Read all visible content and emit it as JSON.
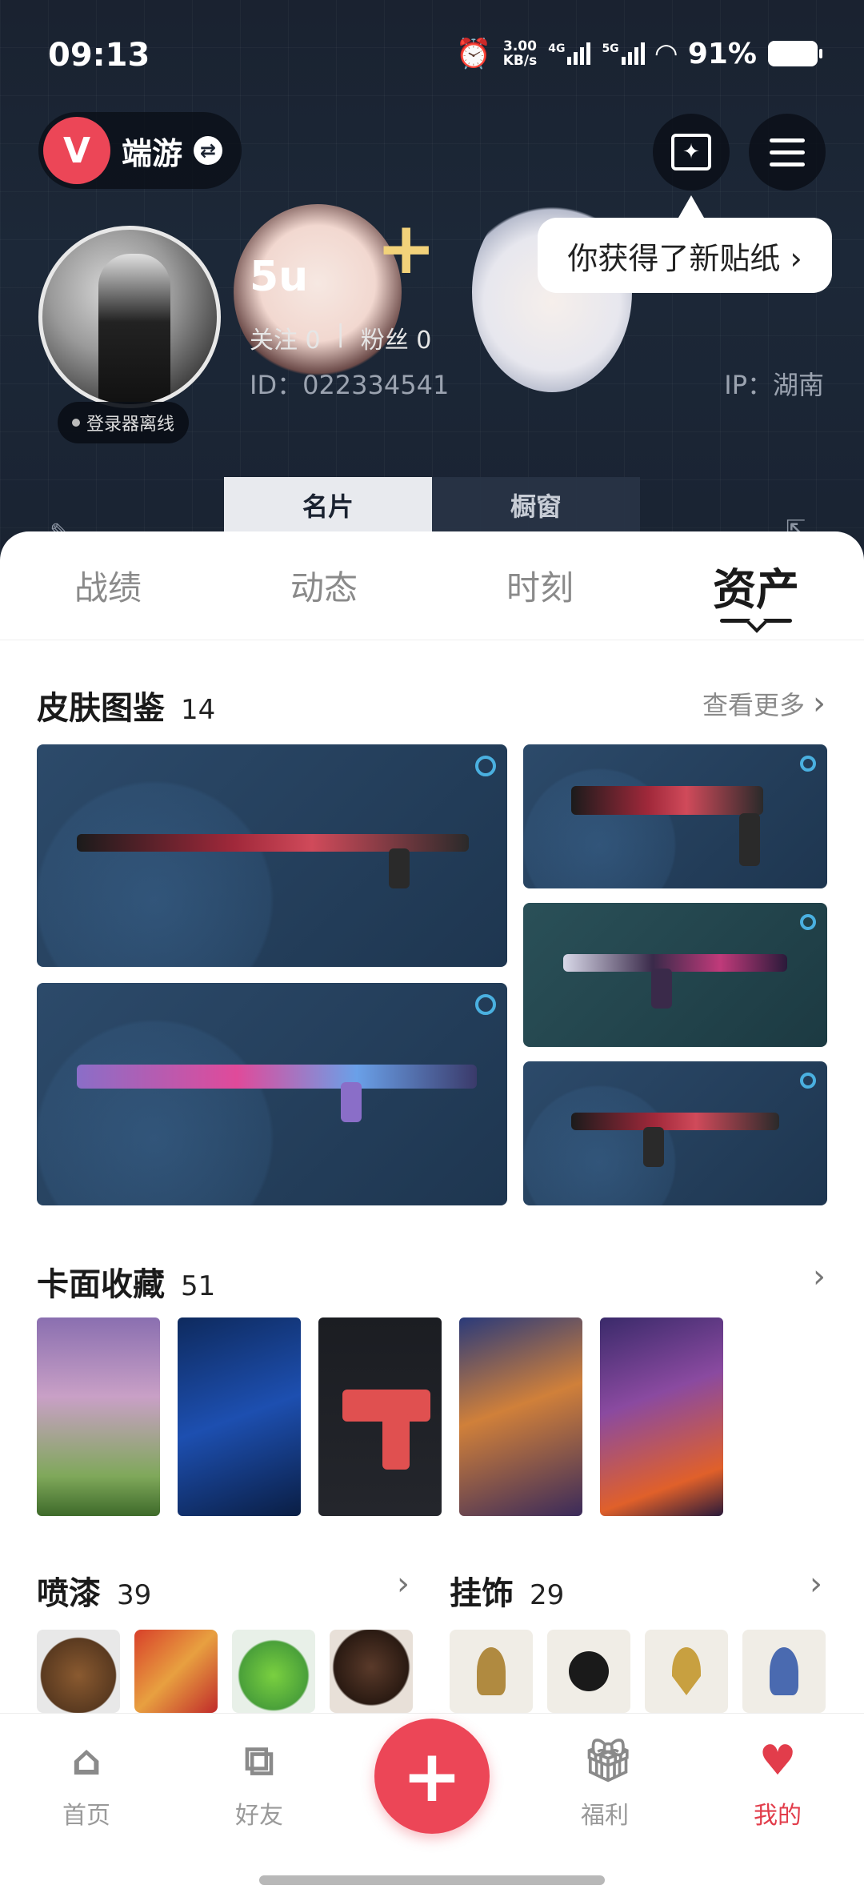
{
  "status_bar": {
    "time": "09:13",
    "speed_value": "3.00",
    "speed_unit": "KB/s",
    "network_1": "4G",
    "network_2": "5G",
    "battery": "91%"
  },
  "header": {
    "game_name": "端游",
    "sticker_tooltip": "你获得了新贴纸 ›"
  },
  "profile": {
    "username": "5u",
    "follow_label": "关注 0",
    "divider": "|",
    "fans_label": "粉丝 0",
    "id": "ID：022334541",
    "ip": "IP：湖南",
    "login_status": "登录器离线"
  },
  "card_tabs": [
    {
      "label": "名片",
      "active": true
    },
    {
      "label": "橱窗",
      "active": false
    }
  ],
  "main_tabs": [
    {
      "label": "战绩",
      "active": false
    },
    {
      "label": "动态",
      "active": false
    },
    {
      "label": "时刻",
      "active": false
    },
    {
      "label": "资产",
      "active": true
    }
  ],
  "skins": {
    "title": "皮肤图鉴",
    "count": "14",
    "more_label": "查看更多"
  },
  "cards": {
    "title": "卡面收藏",
    "count": "51"
  },
  "sprays": {
    "title": "喷漆",
    "count": "39"
  },
  "charms": {
    "title": "挂饰",
    "count": "29"
  },
  "bottom_nav": [
    {
      "label": "首页",
      "icon": "home-icon"
    },
    {
      "label": "好友",
      "icon": "friends-icon"
    },
    {
      "label": "",
      "icon": "plus-icon"
    },
    {
      "label": "福利",
      "icon": "gift-icon"
    },
    {
      "label": "我的",
      "icon": "profile-icon",
      "active": true
    }
  ],
  "colors": {
    "accent": "#ec4657",
    "hero_bg": "#1a2230",
    "active_nav": "#e23d4b"
  }
}
